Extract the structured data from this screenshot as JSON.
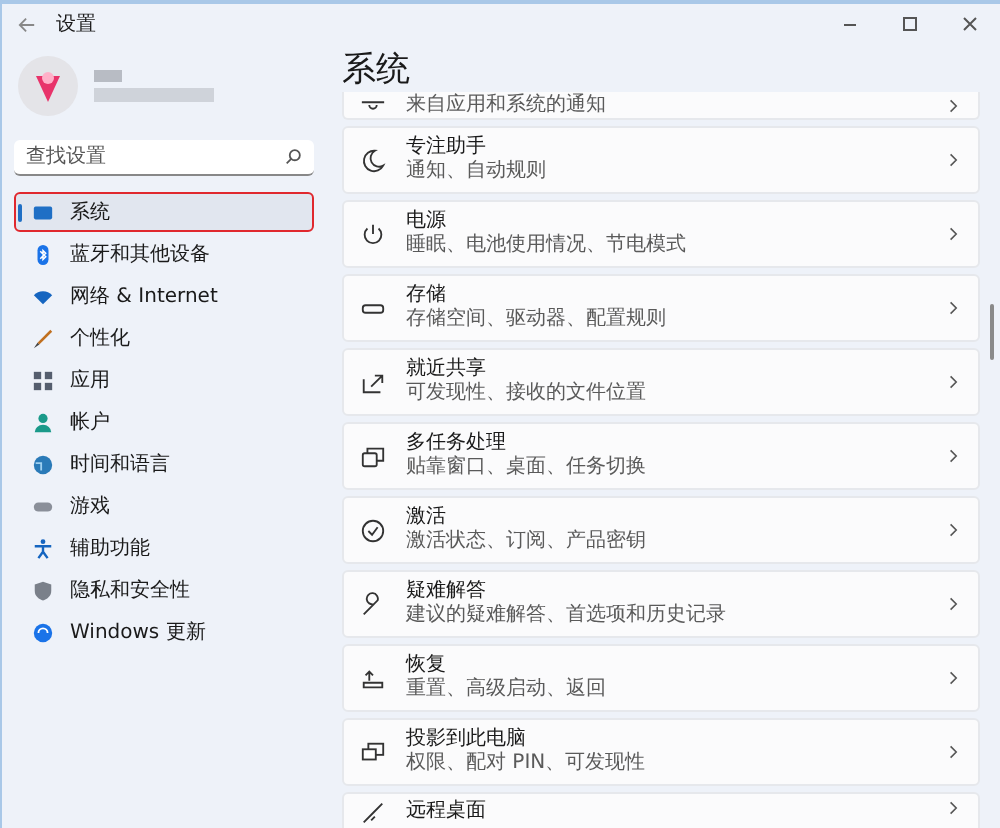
{
  "window": {
    "title": "设置"
  },
  "search": {
    "placeholder": "查找设置"
  },
  "sidebar": {
    "items": [
      {
        "label": "系统",
        "selected": true,
        "highlighted": true
      },
      {
        "label": "蓝牙和其他设备",
        "selected": false,
        "highlighted": false
      },
      {
        "label": "网络 & Internet",
        "selected": false,
        "highlighted": false
      },
      {
        "label": "个性化",
        "selected": false,
        "highlighted": false
      },
      {
        "label": "应用",
        "selected": false,
        "highlighted": false
      },
      {
        "label": "帐户",
        "selected": false,
        "highlighted": false
      },
      {
        "label": "时间和语言",
        "selected": false,
        "highlighted": false
      },
      {
        "label": "游戏",
        "selected": false,
        "highlighted": false
      },
      {
        "label": "辅助功能",
        "selected": false,
        "highlighted": false
      },
      {
        "label": "隐私和安全性",
        "selected": false,
        "highlighted": false
      },
      {
        "label": "Windows 更新",
        "selected": false,
        "highlighted": false
      }
    ]
  },
  "page": {
    "title": "系统",
    "cards": [
      {
        "kind": "partial_top",
        "subtitle": "来自应用和系统的通知"
      },
      {
        "kind": "full",
        "title": "专注助手",
        "subtitle": "通知、自动规则"
      },
      {
        "kind": "full",
        "title": "电源",
        "subtitle": "睡眠、电池使用情况、节电模式"
      },
      {
        "kind": "full",
        "title": "存储",
        "subtitle": "存储空间、驱动器、配置规则"
      },
      {
        "kind": "full",
        "title": "就近共享",
        "subtitle": "可发现性、接收的文件位置"
      },
      {
        "kind": "full",
        "title": "多任务处理",
        "subtitle": "贴靠窗口、桌面、任务切换"
      },
      {
        "kind": "full",
        "title": "激活",
        "subtitle": "激活状态、订阅、产品密钥"
      },
      {
        "kind": "full",
        "title": "疑难解答",
        "subtitle": "建议的疑难解答、首选项和历史记录"
      },
      {
        "kind": "full",
        "title": "恢复",
        "subtitle": "重置、高级启动、返回"
      },
      {
        "kind": "full",
        "title": "投影到此电脑",
        "subtitle": "权限、配对 PIN、可发现性"
      },
      {
        "kind": "partial_bottom",
        "title": "远程桌面"
      }
    ]
  }
}
